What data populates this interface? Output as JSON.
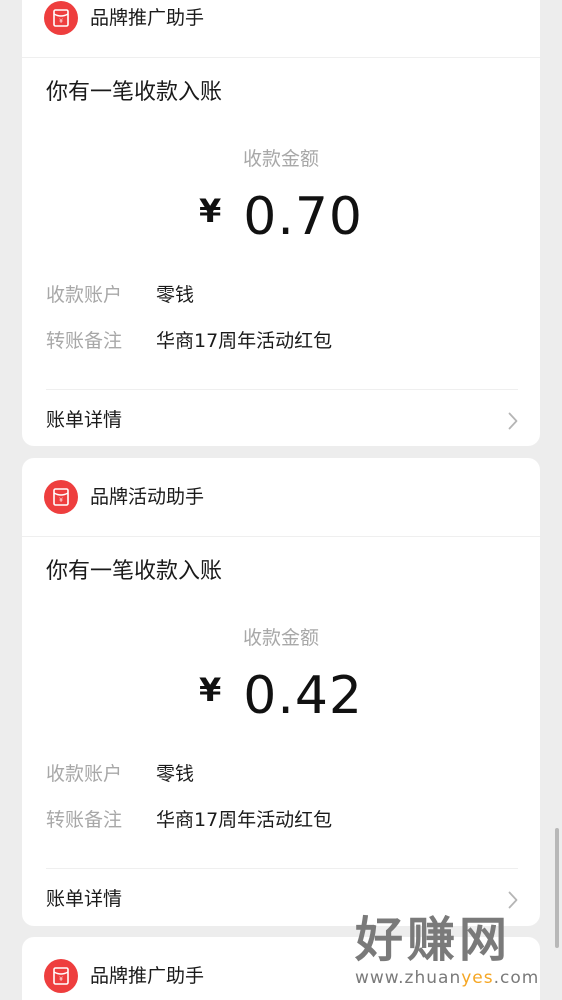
{
  "cards": [
    {
      "sender": "品牌推广助手",
      "headline": "你有一笔收款入账",
      "amount_label": "收款金额",
      "currency": "¥",
      "amount": "0.70",
      "account_label": "收款账户",
      "account_value": "零钱",
      "note_label": "转账备注",
      "note_value": "华商17周年活动红包",
      "detail_label": "账单详情"
    },
    {
      "sender": "品牌活动助手",
      "headline": "你有一笔收款入账",
      "amount_label": "收款金额",
      "currency": "¥",
      "amount": "0.42",
      "account_label": "收款账户",
      "account_value": "零钱",
      "note_label": "转账备注",
      "note_value": "华商17周年活动红包",
      "detail_label": "账单详情"
    },
    {
      "sender": "品牌推广助手"
    }
  ],
  "watermark": {
    "title": "好赚网",
    "url_prefix": "www.zhuan",
    "url_highlight": "yes",
    "url_suffix": ".com"
  },
  "colors": {
    "background": "#ededed",
    "card": "#ffffff",
    "avatar_red": "#ee3e3e",
    "label_gray": "#a8a8a8",
    "watermark_orange": "#f5a623"
  },
  "icons": {
    "avatar": "red-packet-icon",
    "chevron": "chevron-right-icon"
  }
}
